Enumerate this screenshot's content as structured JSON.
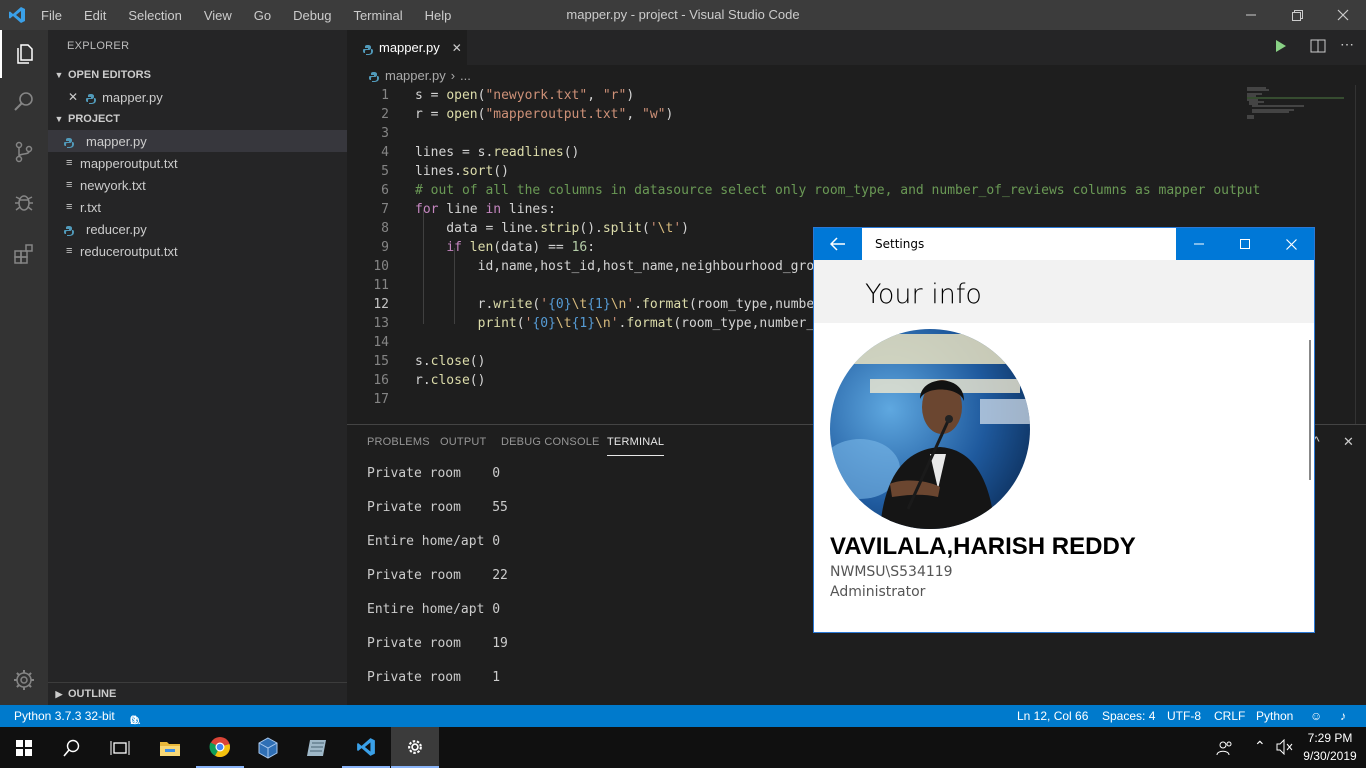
{
  "titlebar": {
    "menu": [
      "File",
      "Edit",
      "Selection",
      "View",
      "Go",
      "Debug",
      "Terminal",
      "Help"
    ],
    "title": "mapper.py - project - Visual Studio Code"
  },
  "sidebar": {
    "header": "EXPLORER",
    "open_editors_label": "OPEN EDITORS",
    "open_editors": [
      {
        "name": "mapper.py"
      }
    ],
    "project_label": "PROJECT",
    "files": [
      {
        "name": "mapper.py",
        "type": "py"
      },
      {
        "name": "mapperoutput.txt",
        "type": "txt"
      },
      {
        "name": "newyork.txt",
        "type": "txt"
      },
      {
        "name": "r.txt",
        "type": "txt"
      },
      {
        "name": "reducer.py",
        "type": "py"
      },
      {
        "name": "reduceroutput.txt",
        "type": "txt"
      }
    ],
    "outline_label": "OUTLINE"
  },
  "editor": {
    "tab": "mapper.py",
    "breadcrumb_file": "mapper.py",
    "breadcrumb_rest": "...",
    "line_numbers": [
      "1",
      "2",
      "3",
      "4",
      "5",
      "6",
      "7",
      "8",
      "9",
      "10",
      "11",
      "12",
      "13",
      "14",
      "15",
      "16",
      "17"
    ],
    "current_line": "12"
  },
  "panel": {
    "tabs": [
      "PROBLEMS",
      "OUTPUT",
      "DEBUG CONSOLE",
      "TERMINAL"
    ],
    "active_tab": "TERMINAL",
    "terminal_lines": [
      "Private room    0",
      "Private room    55",
      "Entire home/apt 0",
      "Private room    22",
      "Entire home/apt 0",
      "Private room    19",
      "Private room    1"
    ]
  },
  "statusbar": {
    "python": "Python 3.7.3 32-bit",
    "errors": "0",
    "warnings": "0",
    "position": "Ln 12, Col 66",
    "spaces": "Spaces: 4",
    "encoding": "UTF-8",
    "eol": "CRLF",
    "language": "Python"
  },
  "taskbar": {
    "time": "7:29 PM",
    "date": "9/30/2019"
  },
  "settings": {
    "title": "Settings",
    "heading": "Your info",
    "name": "VAVILALA,HARISH REDDY",
    "account": "NWMSU\\S534119",
    "role": "Administrator"
  },
  "colors": {
    "accent": "#007acc",
    "settings_blue": "#0078d7",
    "python_icon": "#519aba"
  }
}
